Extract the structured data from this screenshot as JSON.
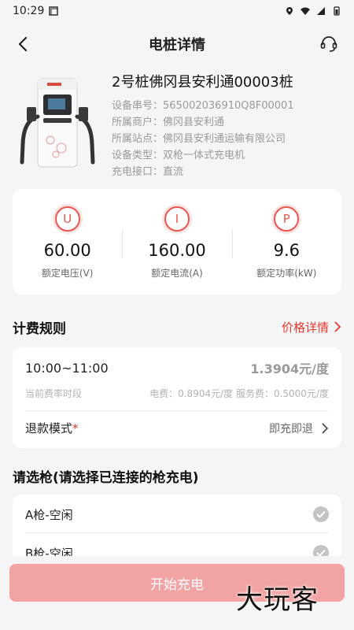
{
  "status_bar": {
    "time": "10:29"
  },
  "nav": {
    "title": "电桩详情"
  },
  "pile": {
    "name": "2号桩佛冈县安利通00003桩",
    "details": [
      "设备串号：565002036910Q8F00001",
      "所属商户：佛冈县安利通",
      "所属站点：佛冈县安利通运输有限公司",
      "设备类型：双枪一体式充电机",
      "充电接口：直流"
    ]
  },
  "specs": [
    {
      "icon": "voltage-icon",
      "glyph": "U",
      "value": "60.00",
      "label": "额定电压(V)"
    },
    {
      "icon": "current-icon",
      "glyph": "I",
      "value": "160.00",
      "label": "额定电流(A)"
    },
    {
      "icon": "power-icon",
      "glyph": "P",
      "value": "9.6",
      "label": "额定功率(kW)"
    }
  ],
  "billing": {
    "section_title": "计费规则",
    "price_detail_link": "价格详情",
    "period": "10:00~11:00",
    "price": "1.3904元/度",
    "current_period_label": "当前费率时段",
    "fee_breakdown": "电费：0.8904元/度 服务费：0.5000元/度",
    "refund_label": "退款模式",
    "refund_required_mark": "*",
    "refund_value": "即充即退"
  },
  "guns": {
    "section_title": "请选枪(请选择已连接的枪充电)",
    "items": [
      {
        "label": "A枪-空闲"
      },
      {
        "label": "B枪-空闲"
      }
    ]
  },
  "actions": {
    "start_label": "开始充电"
  },
  "watermark": "大玩客",
  "colors": {
    "accent": "#e8382f",
    "button": "#f2a3a3",
    "background": "#f5f5f5"
  }
}
